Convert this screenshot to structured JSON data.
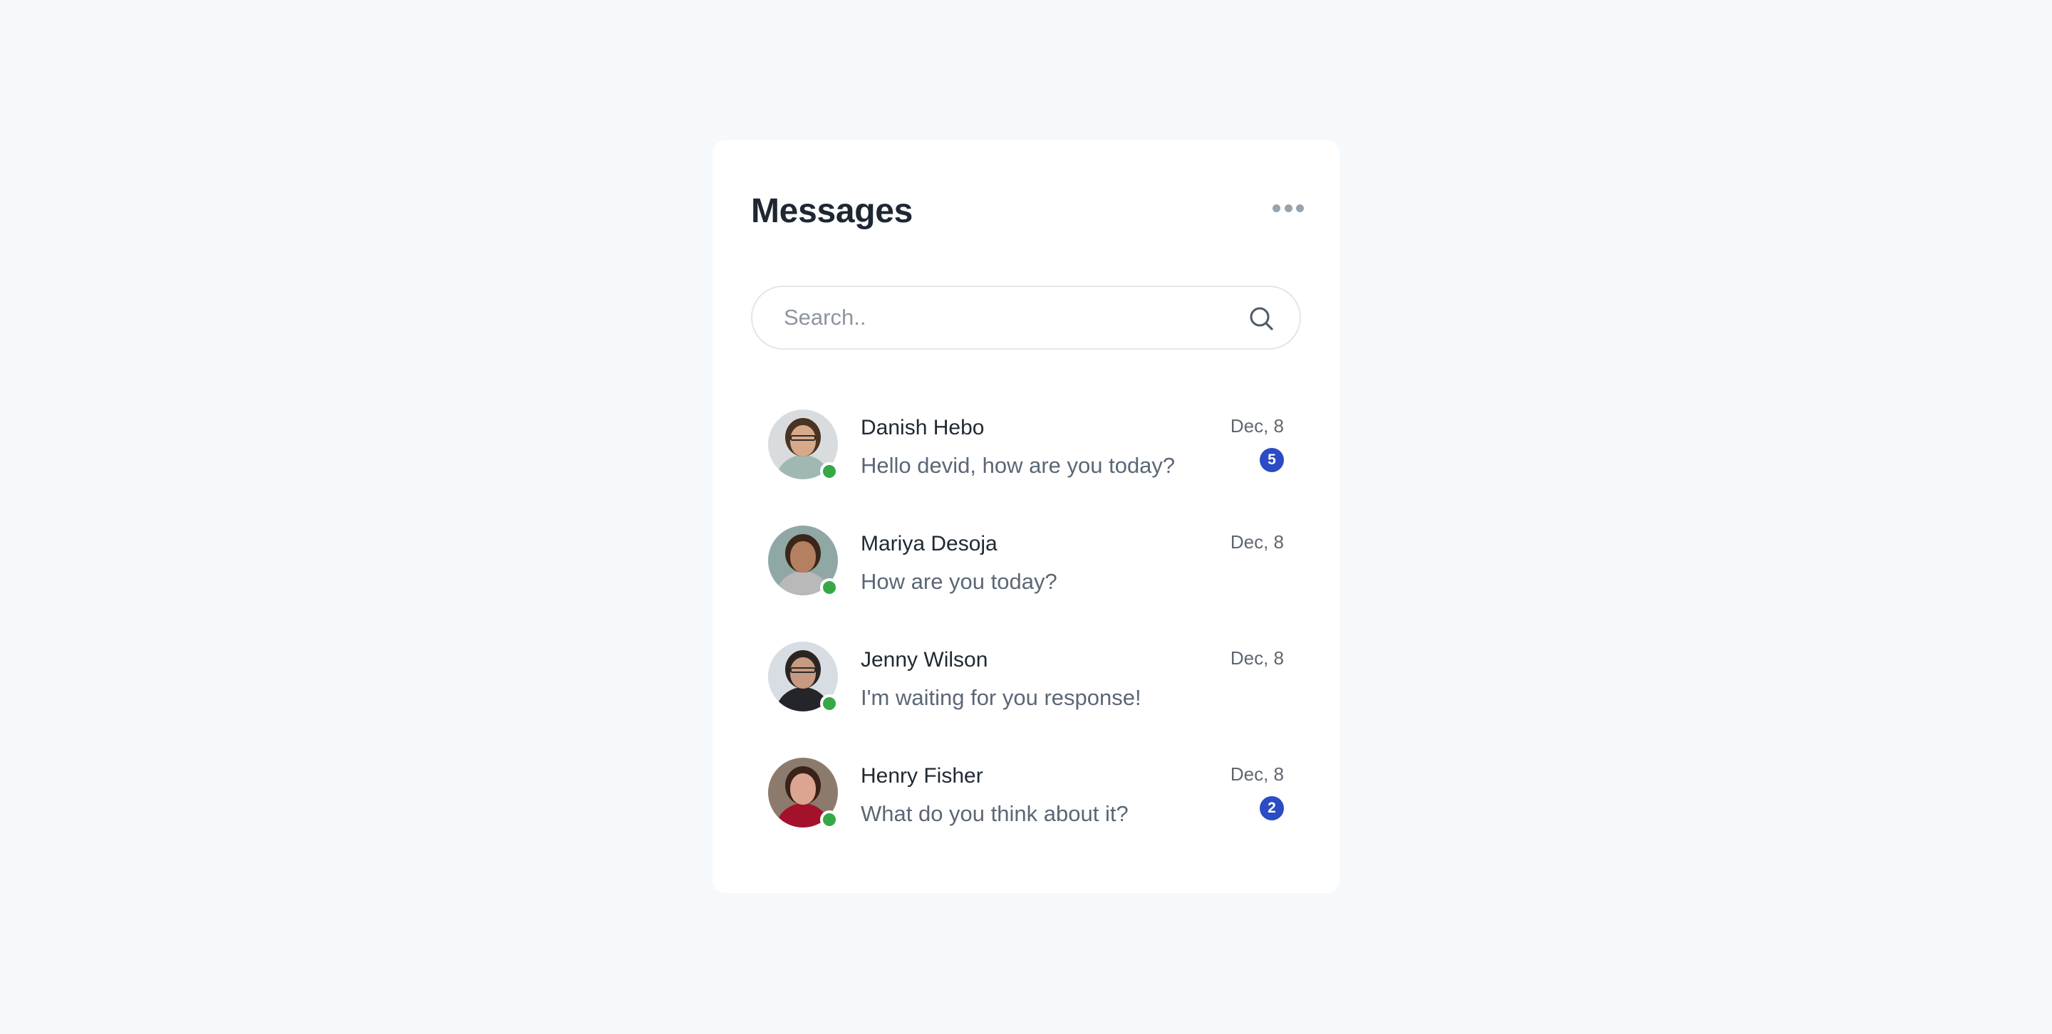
{
  "header": {
    "title": "Messages",
    "more_icon": "more-horizontal-icon"
  },
  "search": {
    "placeholder": "Search..",
    "value": "",
    "icon": "search-icon"
  },
  "conversations": [
    {
      "name": "Danish Hebo",
      "message": "Hello devid, how are you today?",
      "date": "Dec, 8",
      "unread": "5",
      "online": true,
      "avatar_colors": {
        "bg": "#d9dcdf",
        "body": "#9fb9b2",
        "hair": "#4a3322",
        "face": "#d7a98a",
        "glasses": true
      }
    },
    {
      "name": "Mariya Desoja",
      "message": "How are you today?",
      "date": "Dec, 8",
      "unread": null,
      "online": true,
      "avatar_colors": {
        "bg": "#8fa8a6",
        "body": "#b9b9b9",
        "hair": "#3b2619",
        "face": "#b57f62",
        "glasses": false
      }
    },
    {
      "name": "Jenny Wilson",
      "message": "I'm waiting for you response!",
      "date": "Dec, 8",
      "unread": null,
      "online": true,
      "avatar_colors": {
        "bg": "#d7dde3",
        "body": "#232528",
        "hair": "#2a2522",
        "face": "#c79a82",
        "glasses": true
      }
    },
    {
      "name": "Henry Fisher",
      "message": "What do you think about it?",
      "date": "Dec, 8",
      "unread": "2",
      "online": true,
      "avatar_colors": {
        "bg": "#8c7b6d",
        "body": "#a3122a",
        "hair": "#3a2219",
        "face": "#dba590",
        "glasses": false
      }
    }
  ],
  "colors": {
    "page_bg": "#f6f9fc",
    "card_bg": "#ffffff",
    "title": "#1e2732",
    "accent_badge": "#2b4cc4",
    "online": "#36a845",
    "muted_text": "#5b6776"
  }
}
